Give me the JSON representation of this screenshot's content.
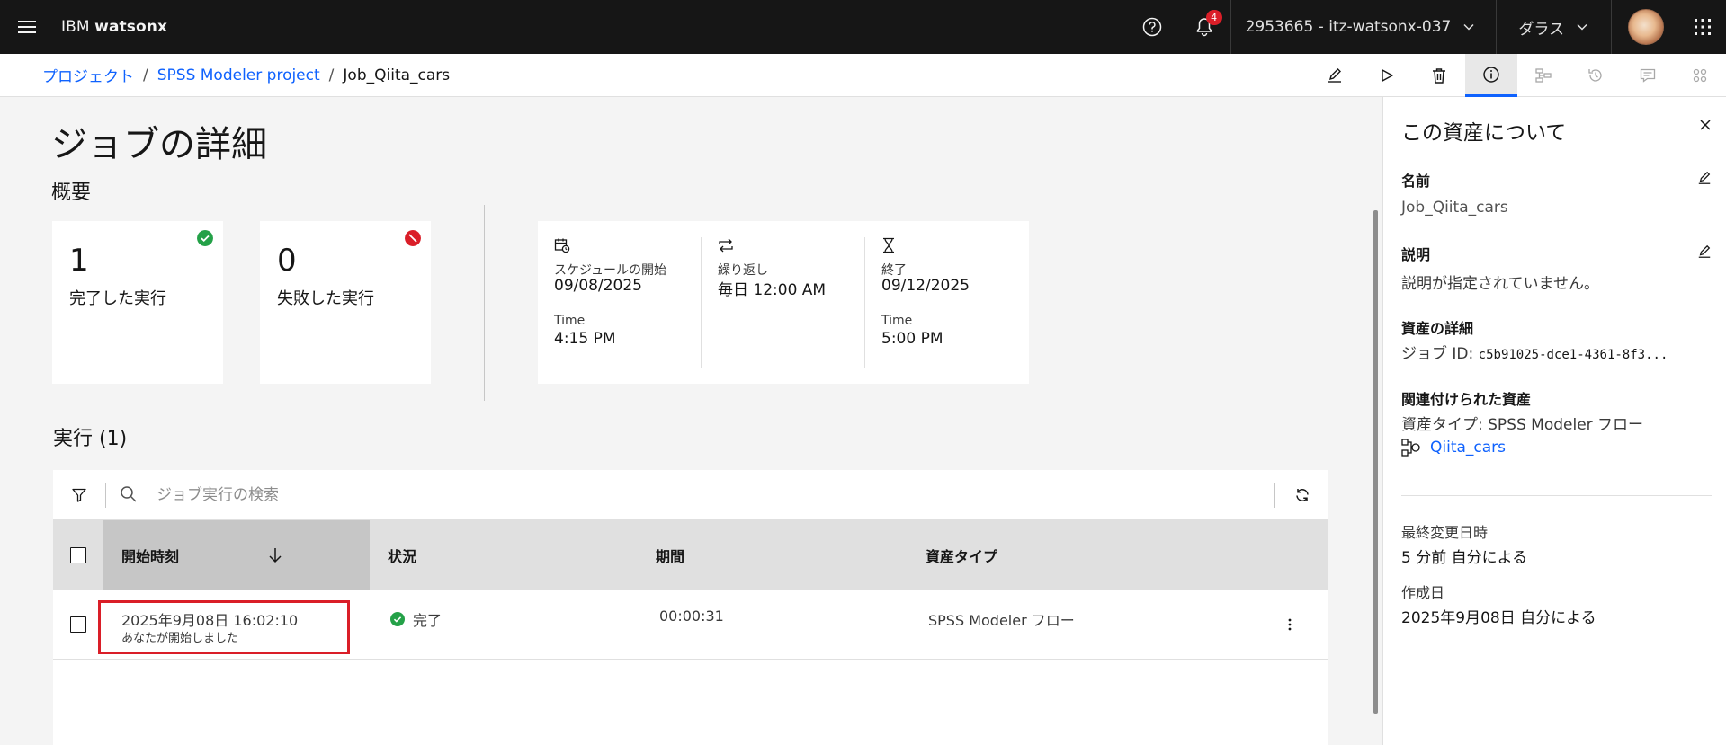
{
  "header": {
    "brand_prefix": "IBM",
    "brand_name": "watsonx",
    "notification_count": "4",
    "account": "2953665 - itz-watsonx-037",
    "region": "ダラス"
  },
  "breadcrumb": {
    "items": [
      "プロジェクト",
      "SPSS Modeler project"
    ],
    "current": "Job_Qiita_cars",
    "separator": "/"
  },
  "page": {
    "title": "ジョブの詳細",
    "overview_title": "概要"
  },
  "stats": {
    "completed": {
      "value": "1",
      "label": "完了した実行"
    },
    "failed": {
      "value": "0",
      "label": "失敗した実行"
    }
  },
  "schedule": {
    "start": {
      "label": "スケジュールの開始",
      "value": "09/08/2025",
      "time_label": "Time",
      "time_value": "4:15 PM"
    },
    "repeat": {
      "label": "繰り返し",
      "value": "毎日 12:00 AM"
    },
    "end": {
      "label": "終了",
      "value": "09/12/2025",
      "time_label": "Time",
      "time_value": "5:00 PM"
    }
  },
  "runs": {
    "title": "実行 (1)",
    "search_placeholder": "ジョブ実行の検索",
    "columns": [
      "開始時刻",
      "状況",
      "期間",
      "資産タイプ"
    ],
    "rows": [
      {
        "start_time": "2025年9月08日 16:02:10",
        "started_by": "あなたが開始しました",
        "status": "完了",
        "duration": "00:00:31",
        "duration_sub": "-",
        "asset_type": "SPSS Modeler フロー"
      }
    ]
  },
  "panel": {
    "title": "この資産について",
    "name_label": "名前",
    "name_value": "Job_Qiita_cars",
    "desc_label": "説明",
    "desc_value": "説明が指定されていません。",
    "details_label": "資産の詳細",
    "job_id_label": "ジョブ ID:",
    "job_id_value": "c5b91025-dce1-4361-8f3...",
    "related_label": "関連付けられた資産",
    "related_type": "資産タイプ: SPSS Modeler フロー",
    "related_link": "Qiita_cars",
    "modified_label": "最終変更日時",
    "modified_value": "5 分前 自分による",
    "created_label": "作成日",
    "created_value": "2025年9月08日 自分による"
  },
  "colors": {
    "accent": "#0f62fe",
    "success": "#24a148",
    "error": "#da1e28",
    "header_bg": "#161616"
  },
  "icons": [
    "menu-icon",
    "help-icon",
    "notification-icon",
    "chevron-down-icon",
    "app-switcher-icon",
    "edit-icon",
    "play-icon",
    "delete-icon",
    "info-icon",
    "lineage-icon",
    "history-icon",
    "comment-icon",
    "settings-icon",
    "checkmark-icon",
    "error-icon",
    "calendar-icon",
    "repeat-icon",
    "hourglass-icon",
    "filter-icon",
    "search-icon",
    "refresh-icon",
    "arrow-down-icon",
    "overflow-menu-icon",
    "close-icon",
    "flow-icon"
  ]
}
